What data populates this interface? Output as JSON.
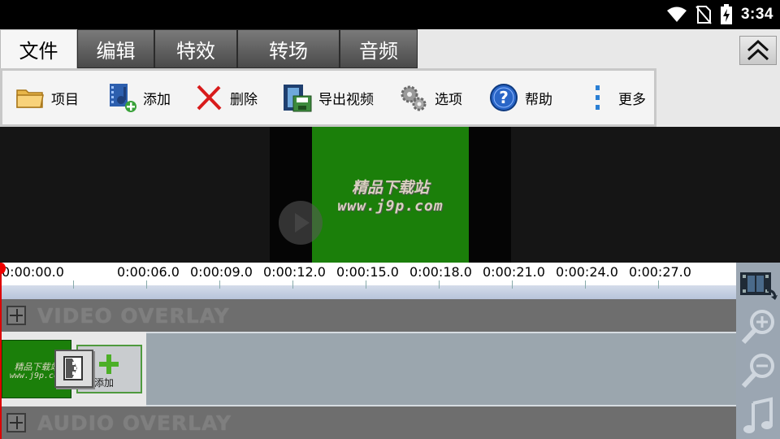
{
  "status_bar": {
    "time": "3:34",
    "icons": [
      "wifi-icon",
      "no-sim-icon",
      "battery-charging-icon"
    ]
  },
  "menu": {
    "tabs": [
      {
        "label": "文件",
        "active": true
      },
      {
        "label": "编辑",
        "active": false
      },
      {
        "label": "特效",
        "active": false
      },
      {
        "label": "转场",
        "active": false
      },
      {
        "label": "音频",
        "active": false
      }
    ],
    "collapse_icon": "double-chevron-up-icon"
  },
  "toolbar": {
    "items": [
      {
        "label": "项目",
        "icon": "folder-icon"
      },
      {
        "label": "添加",
        "icon": "add-media-icon"
      },
      {
        "label": "删除",
        "icon": "delete-x-icon"
      },
      {
        "label": "导出视频",
        "icon": "export-video-icon"
      },
      {
        "label": "选项",
        "icon": "gears-icon"
      },
      {
        "label": "帮助",
        "icon": "help-icon"
      },
      {
        "label": "更多",
        "icon": "more-vertical-icon"
      }
    ]
  },
  "preview": {
    "watermark_line1": "精品下载站",
    "watermark_line2": "www.j9p.com",
    "play_icon": "play-icon"
  },
  "timeline": {
    "ticks": [
      "0:00:00.0",
      "0:00:06.0",
      "0:00:09.0",
      "0:00:12.0",
      "0:00:15.0",
      "0:00:18.0",
      "0:00:21.0",
      "0:00:24.0",
      "0:00:27.0"
    ],
    "video_overlay_label": "VIDEO OVERLAY",
    "audio_overlay_label": "AUDIO OVERLAY",
    "clip": {
      "line1": "精品下载站",
      "line2": "www.j9p.com"
    },
    "add_label": "添加"
  },
  "side_panel": {
    "buttons": [
      "film-strip-icon",
      "zoom-in-icon",
      "zoom-out-icon",
      "music-note-icon"
    ]
  }
}
